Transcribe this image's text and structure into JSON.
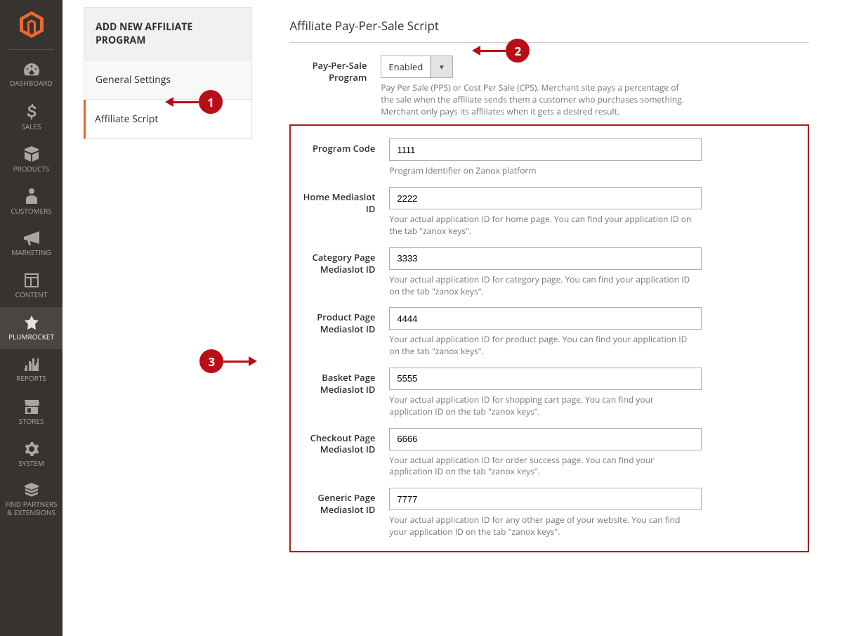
{
  "sidebar": {
    "items": [
      {
        "label": "DASHBOARD"
      },
      {
        "label": "SALES"
      },
      {
        "label": "PRODUCTS"
      },
      {
        "label": "CUSTOMERS"
      },
      {
        "label": "MARKETING"
      },
      {
        "label": "CONTENT"
      },
      {
        "label": "PLUMROCKET"
      },
      {
        "label": "REPORTS"
      },
      {
        "label": "STORES"
      },
      {
        "label": "SYSTEM"
      },
      {
        "label": "FIND PARTNERS & EXTENSIONS"
      }
    ]
  },
  "tabs": {
    "header": "ADD NEW AFFILIATE PROGRAM",
    "items": [
      {
        "label": "General Settings"
      },
      {
        "label": "Affiliate Script"
      }
    ]
  },
  "section": {
    "title": "Affiliate Pay-Per-Sale Script",
    "enable_label": "Pay-Per-Sale Program",
    "enable_value": "Enabled",
    "enable_help": "Pay Per Sale (PPS) or Cost Per Sale (CPS). Merchant site pays a percentage of the sale when the affiliate sends them a customer who purchases something. Merchant only pays its affiliates when it gets a desired result.",
    "fields": [
      {
        "label": "Program Code",
        "value": "1111",
        "help": "Program identifier on Zanox platform"
      },
      {
        "label": "Home Mediaslot ID",
        "value": "2222",
        "help": "Your actual application ID for home page. You can find your application ID on the tab \"zanox keys\"."
      },
      {
        "label": "Category Page Mediaslot ID",
        "value": "3333",
        "help": "Your actual application ID for category page. You can find your application ID on the tab \"zanox keys\"."
      },
      {
        "label": "Product Page Mediaslot ID",
        "value": "4444",
        "help": "Your actual application ID for product page. You can find your application ID on the tab \"zanox keys\"."
      },
      {
        "label": "Basket Page Mediaslot ID",
        "value": "5555",
        "help": "Your actual application ID for shopping cart page. You can find your application ID on the tab \"zanox keys\"."
      },
      {
        "label": "Checkout Page Mediaslot ID",
        "value": "6666",
        "help": "Your actual application ID for order success page. You can find your application ID on the tab \"zanox keys\"."
      },
      {
        "label": "Generic Page Mediaslot ID",
        "value": "7777",
        "help": "Your actual application ID for any other page of your website. You can find your application ID on the tab \"zanox keys\"."
      }
    ]
  },
  "callouts": {
    "c1": "1",
    "c2": "2",
    "c3": "3"
  }
}
